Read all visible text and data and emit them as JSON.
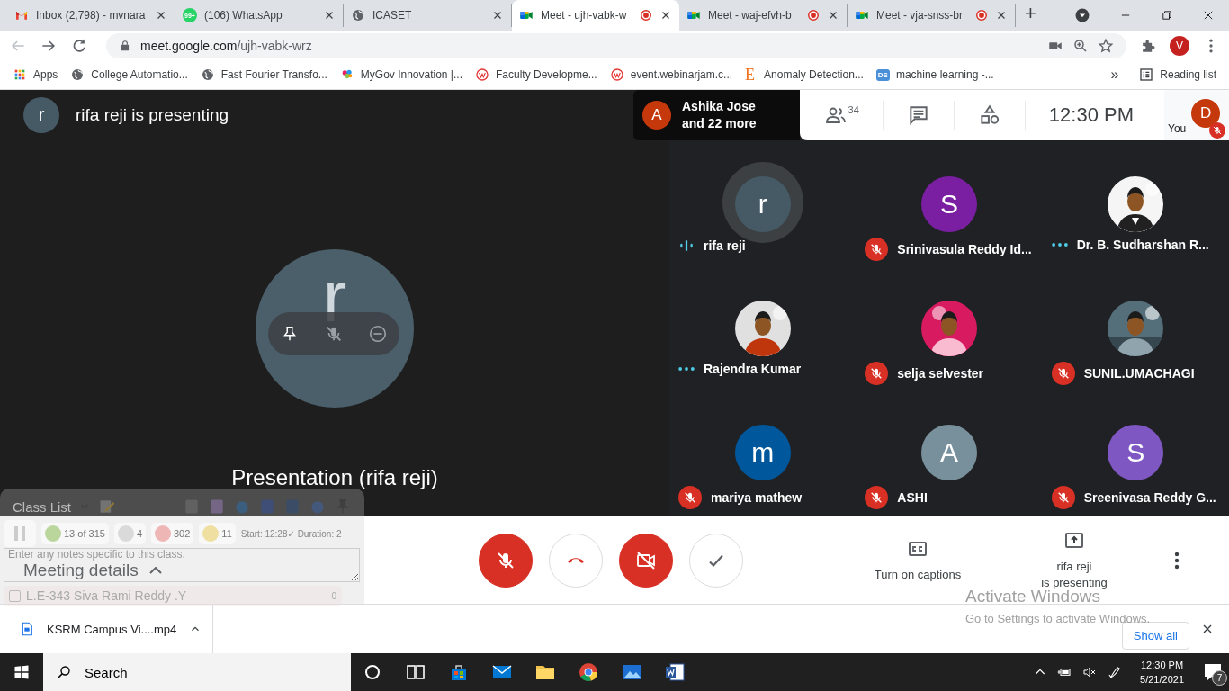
{
  "browser": {
    "tabs": [
      {
        "title": "Inbox (2,798) - mvnara",
        "kind": "gmail",
        "selected": false,
        "recording": false
      },
      {
        "title": "(106) WhatsApp",
        "kind": "whatsapp",
        "badge": "99+",
        "selected": false,
        "recording": false
      },
      {
        "title": "ICASET",
        "kind": "globe",
        "selected": false,
        "recording": false
      },
      {
        "title": "Meet - ujh-vabk-w",
        "kind": "meet",
        "selected": true,
        "recording": true
      },
      {
        "title": "Meet - waj-efvh-b",
        "kind": "meet",
        "selected": false,
        "recording": true
      },
      {
        "title": "Meet - vja-snss-br",
        "kind": "meet",
        "selected": false,
        "recording": true
      }
    ],
    "new_tab": "+",
    "address": {
      "host": "meet.google.com",
      "path": "/ujh-vabk-wrz"
    },
    "profile": "V",
    "bookmarks": [
      {
        "label": "Apps",
        "kind": "apps"
      },
      {
        "label": "College Automatio...",
        "kind": "globe"
      },
      {
        "label": "Fast Fourier Transfo...",
        "kind": "globe"
      },
      {
        "label": "MyGov Innovation |...",
        "kind": "mygov"
      },
      {
        "label": "Faculty Developme...",
        "kind": "webinar"
      },
      {
        "label": "event.webinarjam.c...",
        "kind": "webinar"
      },
      {
        "label": "Anomaly Detection...",
        "kind": "letter",
        "icon_text": "E"
      },
      {
        "label": "machine learning -...",
        "kind": "ds",
        "icon_text": "DS"
      }
    ],
    "more_bookmarks": "»",
    "reading_list": "Reading list"
  },
  "meet": {
    "presenter_header": {
      "letter": "r",
      "text": "rifa reji is presenting"
    },
    "stage": {
      "letter": "r",
      "label": "Presentation (rifa reji)"
    },
    "top_bar": {
      "speaker": {
        "letter": "A",
        "name": "Ashika Jose",
        "more": "and 22 more"
      },
      "people_count": "34",
      "clock": "12:30  PM",
      "self": {
        "letter": "D",
        "label": "You",
        "muted": true
      }
    },
    "participants": [
      {
        "name": "rifa reji",
        "letter": "r",
        "color": "#455a64",
        "speaking": true,
        "muted": false
      },
      {
        "name": "Srinivasula Reddy Id...",
        "letter": "S",
        "color": "#7b1fa2",
        "speaking": false,
        "muted": true
      },
      {
        "name": "Dr. B. Sudharshan R...",
        "kind": "picture",
        "speaking": false,
        "muted": false
      },
      {
        "name": "Rajendra Kumar",
        "kind": "picture",
        "speaking": false,
        "muted": false
      },
      {
        "name": "selja selvester",
        "kind": "picture",
        "speaking": false,
        "muted": true
      },
      {
        "name": "SUNIL.UMACHAGI",
        "kind": "picture",
        "speaking": false,
        "muted": true
      },
      {
        "name": "mariya mathew",
        "letter": "m",
        "color": "#01579b",
        "speaking": false,
        "muted": true
      },
      {
        "name": "ASHI",
        "letter": "A",
        "color": "#78909c",
        "speaking": false,
        "muted": true
      },
      {
        "name": "Sreenivasa Reddy G...",
        "letter": "S",
        "color": "#7e57c2",
        "speaking": false,
        "muted": true
      }
    ],
    "meeting_details": "Meeting details",
    "controls": [
      {
        "kind": "mic",
        "on": false
      },
      {
        "kind": "hangup"
      },
      {
        "kind": "camera",
        "on": false
      },
      {
        "kind": "check"
      }
    ],
    "captions": "Turn on captions",
    "presenting": [
      "rifa reji",
      "is presenting"
    ]
  },
  "class_list": {
    "title": "Class List",
    "present": "13 of 315",
    "ghosts": "4",
    "absent": "302",
    "unknown": "11",
    "timing": "Start: 12:28✓ Duration: 2",
    "notes_placeholder": "Enter any notes specific to this class.",
    "student": "L.E-343 Siva Rami Reddy .Y",
    "student_checked": false,
    "student_count": "0"
  },
  "activation": {
    "title": "Activate Windows",
    "text": "Go to Settings to activate Windows."
  },
  "downloads": {
    "file": "KSRM Campus Vi....mp4",
    "show_all": "Show all"
  },
  "taskbar": {
    "search": "Search",
    "apps": [
      {
        "kind": "cortana"
      },
      {
        "kind": "taskview"
      },
      {
        "kind": "store"
      },
      {
        "kind": "mail"
      },
      {
        "kind": "explorer"
      },
      {
        "kind": "chrome"
      },
      {
        "kind": "photos"
      },
      {
        "kind": "word"
      }
    ],
    "time": "12:30 PM",
    "date": "5/21/2021",
    "notifications": "7"
  }
}
